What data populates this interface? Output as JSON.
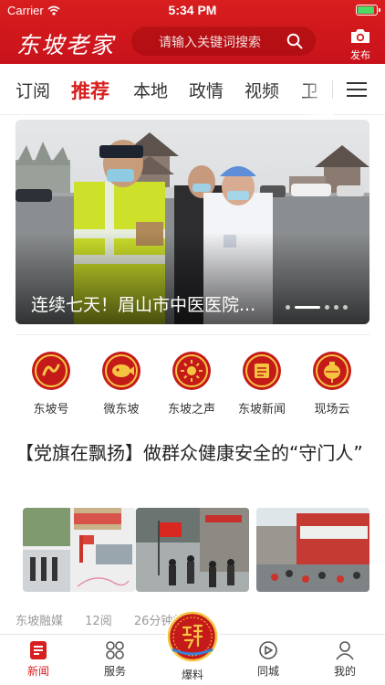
{
  "status_bar": {
    "carrier": "Carrier",
    "time": "5:34 PM"
  },
  "header": {
    "logo": "东坡老家",
    "search_placeholder": "请输入关键词搜索",
    "publish_label": "发布",
    "accent_color": "#d81e1e"
  },
  "tabs": [
    {
      "label": "订阅"
    },
    {
      "label": "推荐",
      "active": true
    },
    {
      "label": "本地"
    },
    {
      "label": "政情"
    },
    {
      "label": "视频"
    },
    {
      "label": "卫"
    }
  ],
  "banner": {
    "caption": "连续七天！眉山市中医医院...",
    "slides_total": 5,
    "slide_active": 1
  },
  "features": [
    {
      "label": "东坡号",
      "icon": "dongpohao-icon"
    },
    {
      "label": "微东坡",
      "icon": "weidongpo-icon"
    },
    {
      "label": "东坡之声",
      "icon": "dongpo-voice-icon"
    },
    {
      "label": "东坡新闻",
      "icon": "dongpo-news-icon"
    },
    {
      "label": "现场云",
      "icon": "live-cloud-icon"
    }
  ],
  "article": {
    "title": "【党旗在飘扬】做群众健康安全的“守门人”",
    "source": "东坡融媒",
    "reads": "12阅",
    "time": "26分钟前"
  },
  "bottom_nav": [
    {
      "label": "新闻",
      "active": true,
      "icon": "news-icon"
    },
    {
      "label": "服务",
      "icon": "services-icon"
    },
    {
      "label": "爆料",
      "icon": "fu-icon"
    },
    {
      "label": "同城",
      "icon": "local-city-icon"
    },
    {
      "label": "我的",
      "icon": "profile-icon"
    }
  ]
}
